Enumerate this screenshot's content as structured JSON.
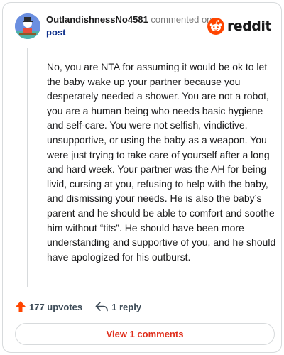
{
  "comment": {
    "username": "OutlandishnessNo4581",
    "action_text": "commented on",
    "target_text": "post",
    "body": "No, you are NTA for assuming it would be ok to let the baby wake up your partner because you desperately needed a shower. You are not a robot, you are a human being who needs basic hygiene and self-care. You were not selfish, vindictive, unsupportive, or using the baby as a weapon. You were just trying to take care of yourself after a long and hard week. Your partner was the AH for being livid, cursing at you, refusing to help with the baby, and dismissing your needs. He is also the baby’s parent and he should be able to comfort and soothe him without “tits”. He should have been more understanding and supportive of you, and he should have apologized for his outburst."
  },
  "brand": {
    "wordmark": "reddit",
    "accent_color": "#ff4500"
  },
  "actions": {
    "upvotes_label": "177 upvotes",
    "reply_label": "1 reply"
  },
  "footer": {
    "view_comments_label": "View 1 comments"
  },
  "icons": {
    "avatar": "avatar",
    "logo": "reddit-alien-icon",
    "upvote": "upvote-arrow-icon",
    "reply": "reply-arrow-icon"
  }
}
